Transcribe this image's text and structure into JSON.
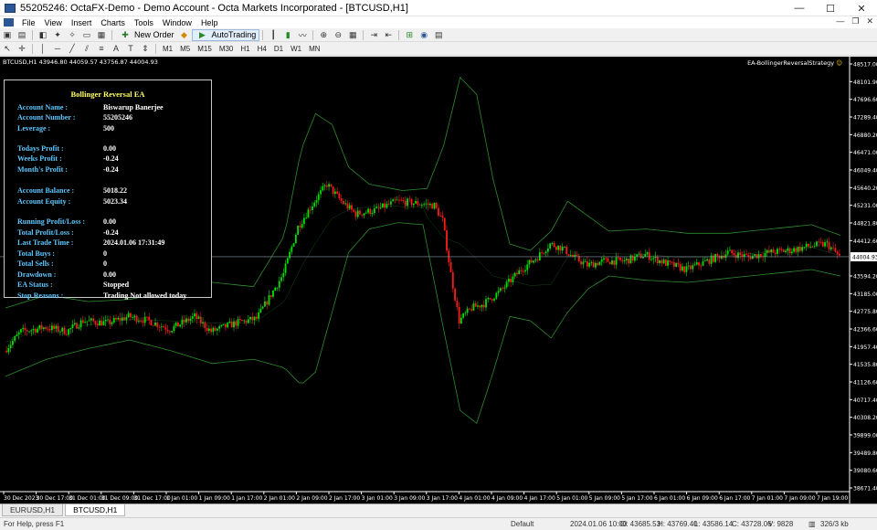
{
  "window": {
    "title": "55205246: OctaFX-Demo - Demo Account - Octa Markets Incorporated - [BTCUSD,H1]",
    "minimize": "—",
    "maximize": "☐",
    "close": "✕"
  },
  "menu": {
    "items": [
      "File",
      "View",
      "Insert",
      "Charts",
      "Tools",
      "Window",
      "Help"
    ],
    "mdi_minimize": "—",
    "mdi_restore": "❐",
    "mdi_close": "✕"
  },
  "toolbar": {
    "new_order": "New Order",
    "autotrading": "AutoTrading",
    "timeframes": [
      "M1",
      "M5",
      "M15",
      "M30",
      "H1",
      "H4",
      "D1",
      "W1",
      "MN"
    ],
    "active_timeframe": "H1"
  },
  "chart": {
    "symbol_info": "BTCUSD,H1  43946.80 44059.57 43756.87 44004.93",
    "ea_name": "EA-BollingerReversalStrategy",
    "smiley": "☺",
    "background": "#000000",
    "bull_color": "#00e000",
    "bear_color": "#ff1a1a",
    "band_color": "#2e8b2e",
    "current_price_label": "44004.93"
  },
  "chart_data": {
    "type": "candlestick",
    "symbol": "BTCUSD",
    "timeframe": "H1",
    "y_ticks": [
      "48517.00",
      "48101.90",
      "47696.60",
      "47289.40",
      "46880.20",
      "46471.00",
      "46049.40",
      "45640.20",
      "45231.00",
      "44821.80",
      "44412.60",
      "44004.93",
      "43594.20",
      "43185.00",
      "42775.80",
      "42366.60",
      "41957.40",
      "41535.80",
      "41126.60",
      "40717.40",
      "40308.20",
      "39899.00",
      "39489.80",
      "39080.60",
      "38671.40"
    ],
    "x_ticks": [
      "30 Dec 2023",
      "30 Dec 17:00",
      "31 Dec 01:00",
      "31 Dec 09:00",
      "31 Dec 17:00",
      "1 Jan 01:00",
      "1 Jan 09:00",
      "1 Jan 17:00",
      "2 Jan 01:00",
      "2 Jan 09:00",
      "2 Jan 17:00",
      "3 Jan 01:00",
      "3 Jan 09:00",
      "3 Jan 17:00",
      "4 Jan 01:00",
      "4 Jan 09:00",
      "4 Jan 17:00",
      "5 Jan 01:00",
      "5 Jan 09:00",
      "5 Jan 17:00",
      "6 Jan 01:00",
      "6 Jan 09:00",
      "6 Jan 17:00",
      "7 Jan 01:00",
      "7 Jan 09:00",
      "7 Jan 19:00"
    ],
    "ylim": [
      38500,
      48600
    ],
    "close_path": [
      [
        0,
        41800
      ],
      [
        8,
        42250
      ],
      [
        20,
        42350
      ],
      [
        30,
        42250
      ],
      [
        38,
        42500
      ],
      [
        50,
        42450
      ],
      [
        60,
        42600
      ],
      [
        70,
        42500
      ],
      [
        80,
        42300
      ],
      [
        92,
        42600
      ],
      [
        100,
        42250
      ],
      [
        112,
        42450
      ],
      [
        122,
        42550
      ],
      [
        135,
        43600
      ],
      [
        142,
        44700
      ],
      [
        150,
        45300
      ],
      [
        156,
        45700
      ],
      [
        163,
        45300
      ],
      [
        170,
        45000
      ],
      [
        180,
        45100
      ],
      [
        190,
        45300
      ],
      [
        200,
        45250
      ],
      [
        208,
        45200
      ],
      [
        212,
        44850
      ],
      [
        216,
        43600
      ],
      [
        220,
        42500
      ],
      [
        226,
        42800
      ],
      [
        232,
        42900
      ],
      [
        240,
        43200
      ],
      [
        250,
        43700
      ],
      [
        258,
        44000
      ],
      [
        264,
        44300
      ],
      [
        270,
        44200
      ],
      [
        275,
        44000
      ],
      [
        282,
        43800
      ],
      [
        290,
        43900
      ],
      [
        300,
        43900
      ],
      [
        310,
        44050
      ],
      [
        320,
        43850
      ],
      [
        330,
        43700
      ],
      [
        340,
        43900
      ],
      [
        350,
        44100
      ],
      [
        360,
        44000
      ],
      [
        370,
        44100
      ],
      [
        380,
        44150
      ],
      [
        390,
        44250
      ],
      [
        398,
        44300
      ],
      [
        404,
        44000
      ]
    ],
    "upper_band_path": [
      [
        0,
        42800
      ],
      [
        20,
        43100
      ],
      [
        40,
        42950
      ],
      [
        60,
        43000
      ],
      [
        80,
        43200
      ],
      [
        100,
        43400
      ],
      [
        120,
        43300
      ],
      [
        135,
        44500
      ],
      [
        143,
        46500
      ],
      [
        150,
        47350
      ],
      [
        158,
        47100
      ],
      [
        166,
        46100
      ],
      [
        176,
        45700
      ],
      [
        192,
        45550
      ],
      [
        204,
        45600
      ],
      [
        212,
        46600
      ],
      [
        220,
        48200
      ],
      [
        228,
        47800
      ],
      [
        236,
        45800
      ],
      [
        244,
        44300
      ],
      [
        254,
        44150
      ],
      [
        264,
        44600
      ],
      [
        272,
        45300
      ],
      [
        282,
        44950
      ],
      [
        292,
        44600
      ],
      [
        310,
        44650
      ],
      [
        330,
        44550
      ],
      [
        350,
        44550
      ],
      [
        370,
        44650
      ],
      [
        390,
        44750
      ],
      [
        404,
        44500
      ]
    ],
    "lower_band_path": [
      [
        0,
        41200
      ],
      [
        20,
        41600
      ],
      [
        40,
        41850
      ],
      [
        60,
        42050
      ],
      [
        80,
        41800
      ],
      [
        100,
        41500
      ],
      [
        120,
        41600
      ],
      [
        135,
        41400
      ],
      [
        143,
        41000
      ],
      [
        150,
        41300
      ],
      [
        158,
        42700
      ],
      [
        166,
        44100
      ],
      [
        176,
        44650
      ],
      [
        190,
        44800
      ],
      [
        202,
        44750
      ],
      [
        212,
        42300
      ],
      [
        220,
        40400
      ],
      [
        228,
        40100
      ],
      [
        236,
        41300
      ],
      [
        244,
        42600
      ],
      [
        254,
        42500
      ],
      [
        264,
        42100
      ],
      [
        272,
        42700
      ],
      [
        282,
        43250
      ],
      [
        292,
        43550
      ],
      [
        310,
        43450
      ],
      [
        330,
        43400
      ],
      [
        350,
        43500
      ],
      [
        370,
        43600
      ],
      [
        390,
        43700
      ],
      [
        404,
        43550
      ]
    ]
  },
  "ea_panel": {
    "title": "Bollinger Reversal EA",
    "rows": [
      {
        "label": "Account Name :",
        "value": "Biswarup Banerjee"
      },
      {
        "label": "Account Number :",
        "value": "55205246"
      },
      {
        "label": "Leverage :",
        "value": "500"
      },
      {
        "label": "Todays Profit :",
        "value": "0.00"
      },
      {
        "label": "Weeks Profit :",
        "value": "-0.24"
      },
      {
        "label": "Month's Profit :",
        "value": "-0.24"
      },
      {
        "label": "Account Balance :",
        "value": "5018.22"
      },
      {
        "label": "Account Equity :",
        "value": "5023.34"
      },
      {
        "label": "Running Profit/Loss :",
        "value": "0.00"
      },
      {
        "label": "Total Profit/Loss :",
        "value": "-0.24"
      },
      {
        "label": "Last Trade Time :",
        "value": "2024.01.06 17:31:49"
      },
      {
        "label": "Total Buys :",
        "value": "0"
      },
      {
        "label": "Total Sells :",
        "value": "0"
      },
      {
        "label": "Drawdown :",
        "value": "0.00"
      },
      {
        "label": "EA Status :",
        "value": "Stopped"
      },
      {
        "label": "Stop Reasons :",
        "value": "Trading Not allowed today"
      }
    ]
  },
  "tabs": [
    "EURUSD,H1",
    "BTCUSD,H1"
  ],
  "active_tab": "BTCUSD,H1",
  "status": {
    "help": "For Help, press F1",
    "profile": "Default",
    "time": "2024.01.06 10:00",
    "open": "O: 43685.53",
    "high": "H: 43769.40",
    "low": "L: 43586.14",
    "close": "C: 43728.06",
    "volume": "V: 9828",
    "traffic": "326/3 kb"
  }
}
